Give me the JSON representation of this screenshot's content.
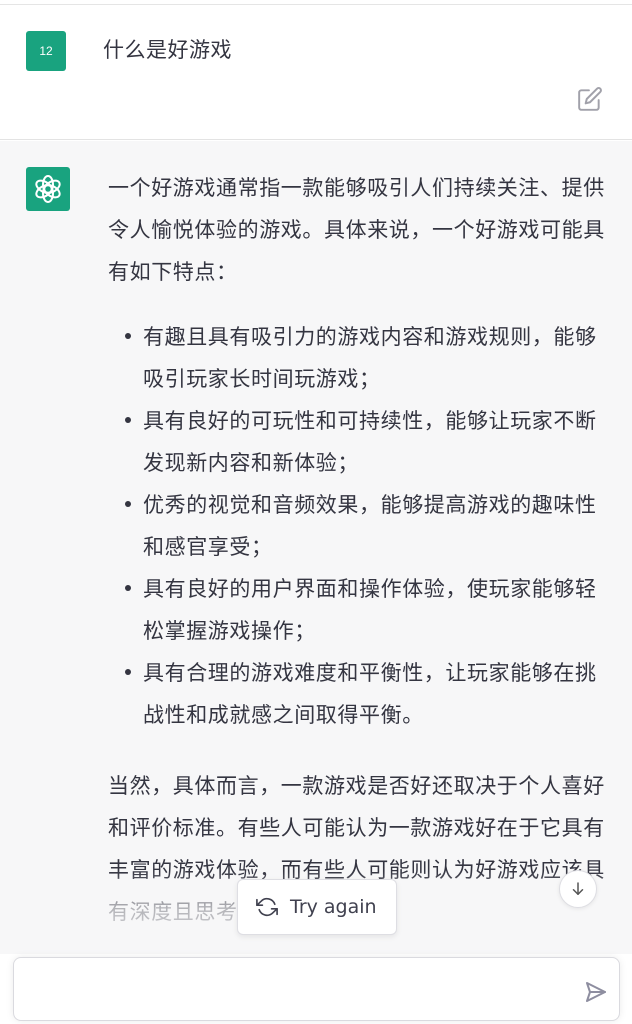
{
  "user_message": {
    "avatar_label": "12",
    "text": "什么是好游戏"
  },
  "assistant_message": {
    "intro": "一个好游戏通常指一款能够吸引人们持续关注、提供令人愉悦体验的游戏。具体来说，一个好游戏可能具有如下特点：",
    "bullets": [
      "有趣且具有吸引力的游戏内容和游戏规则，能够吸引玩家长时间玩游戏；",
      "具有良好的可玩性和可持续性，能够让玩家不断发现新内容和新体验；",
      "优秀的视觉和音频效果，能够提高游戏的趣味性和感官享受；",
      "具有良好的用户界面和操作体验，使玩家能够轻松掌握游戏操作；",
      "具有合理的游戏难度和平衡性，让玩家能够在挑战性和成就感之间取得平衡。"
    ],
    "conclusion": "当然，具体而言，一款游戏是否好还取决于个人喜好和评价标准。有些人可能认为一款游戏好在于它具有丰富的游戏体验，而有些人可能则认为好游戏应该具有深度且思考性的游"
  },
  "controls": {
    "try_again_label": "Try again",
    "input_value": ""
  },
  "icons": {
    "edit": "edit-icon",
    "openai_logo": "openai-logo-icon",
    "refresh": "refresh-icon",
    "scroll_down": "arrow-down-icon",
    "send": "send-icon"
  },
  "colors": {
    "accent": "#19a37f",
    "assistant_bg": "#f7f7f8",
    "text": "#343541"
  }
}
